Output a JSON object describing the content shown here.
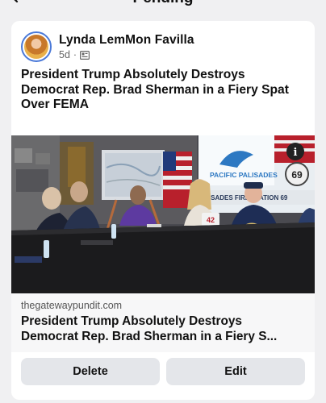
{
  "header": {
    "title": "Pending"
  },
  "post": {
    "author": "Lynda LemMon Favilla",
    "age": "5d",
    "separator": "·",
    "text": "President Trump Absolutely Destroys Democrat Rep. Brad Sherman in a Fiery Spat Over FEMA",
    "image": {
      "sign_text": "PACIFIC PALISADES",
      "banner_text": "LISADES FIRE STATION 69",
      "badge_text": "69",
      "card_text": "42",
      "info_icon": "i"
    },
    "link": {
      "domain": "thegatewaypundit.com",
      "title_line1": "President Trump Absolutely Destroys",
      "title_line2": "Democrat Rep. Brad Sherman in a Fiery S..."
    }
  },
  "actions": {
    "delete_label": "Delete",
    "edit_label": "Edit"
  },
  "colors": {
    "background": "#f0f0f2",
    "card": "#ffffff",
    "button": "#e4e6ea",
    "avatar_ring": "#4a79d8"
  }
}
